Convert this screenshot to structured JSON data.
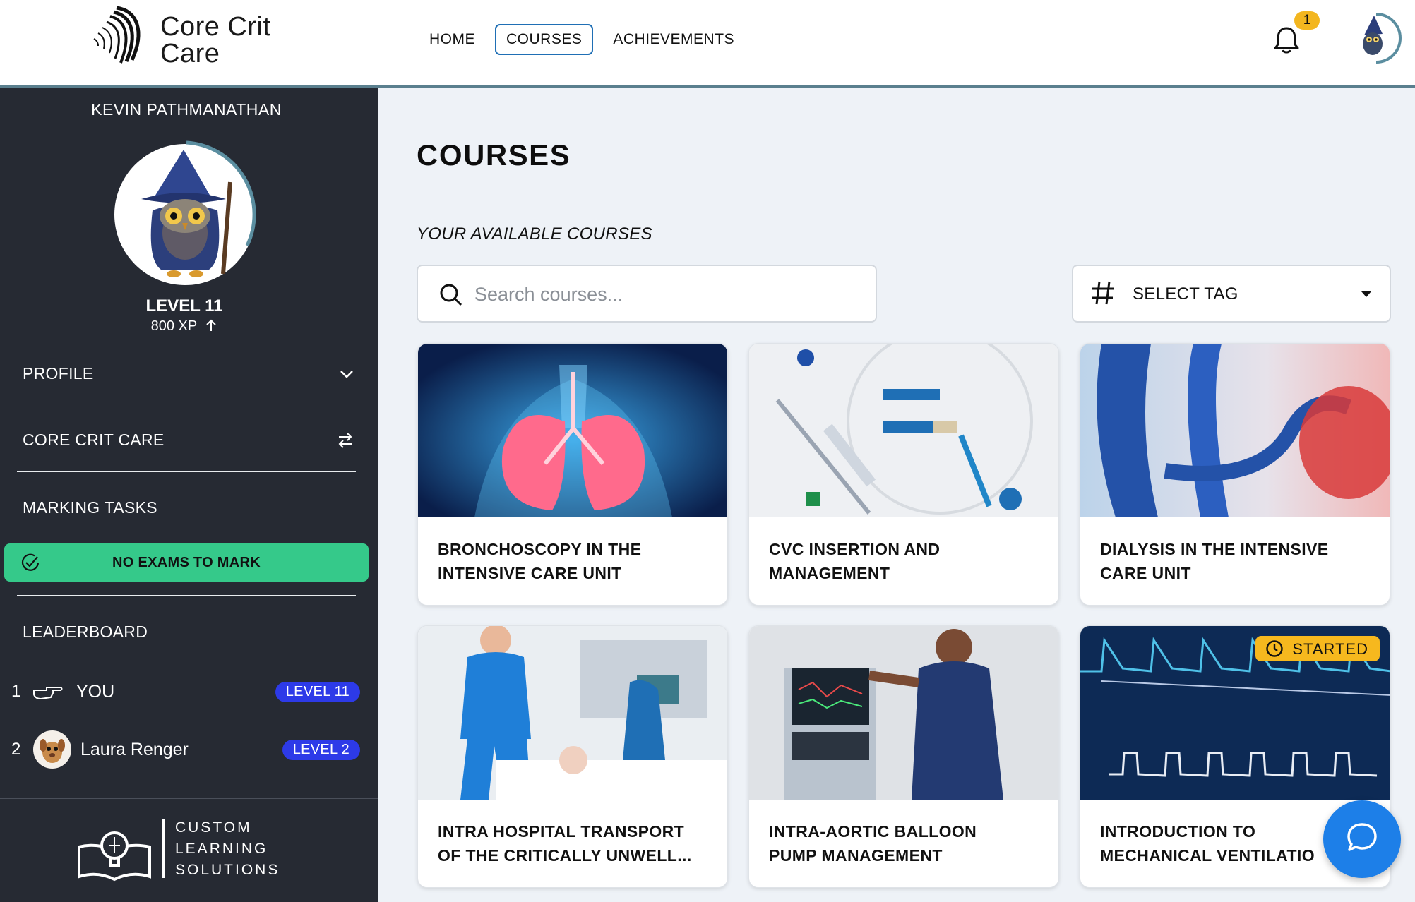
{
  "header": {
    "logo_line1": "Core Crit",
    "logo_line2": "Care",
    "nav": [
      {
        "label": "HOME",
        "active": false
      },
      {
        "label": "COURSES",
        "active": true
      },
      {
        "label": "ACHIEVEMENTS",
        "active": false
      }
    ],
    "notification_count": "1"
  },
  "sidebar": {
    "user_name": "KEVIN PATHMANATHAN",
    "level": "LEVEL 11",
    "xp": "800 XP",
    "profile_label": "PROFILE",
    "org_label": "CORE CRIT CARE",
    "marking_label": "MARKING TASKS",
    "marking_status": "NO EXAMS TO MARK",
    "leaderboard_label": "LEADERBOARD",
    "leaderboard": [
      {
        "rank": "1",
        "name": "YOU",
        "level": "LEVEL 11"
      },
      {
        "rank": "2",
        "name": "Laura Renger",
        "level": "LEVEL 2"
      }
    ],
    "footer": {
      "line1": "CUSTOM",
      "line2": "LEARNING",
      "line3": "SOLUTIONS"
    }
  },
  "main": {
    "title": "COURSES",
    "subtitle": "YOUR AVAILABLE COURSES",
    "search_placeholder": "Search courses...",
    "tag_label": "SELECT TAG",
    "courses": [
      {
        "line1": "BRONCHOSCOPY IN THE",
        "line2": "INTENSIVE CARE UNIT"
      },
      {
        "line1": "CVC INSERTION AND",
        "line2": "MANAGEMENT"
      },
      {
        "line1": "DIALYSIS IN THE INTENSIVE",
        "line2": "CARE UNIT"
      },
      {
        "line1": "INTRA HOSPITAL TRANSPORT",
        "line2": "OF THE CRITICALLY UNWELL..."
      },
      {
        "line1": "INTRA-AORTIC BALLOON",
        "line2": "PUMP MANAGEMENT"
      },
      {
        "line1": "INTRODUCTION TO",
        "line2": "MECHANICAL VENTILATIO",
        "badge": "STARTED"
      }
    ]
  },
  "colors": {
    "accent": "#1f6fb5",
    "sidebar": "#262a33",
    "success": "#35c98a",
    "level_badge": "#2d3ae8",
    "started_badge": "#f6b81e",
    "chat": "#1d7fe8"
  }
}
